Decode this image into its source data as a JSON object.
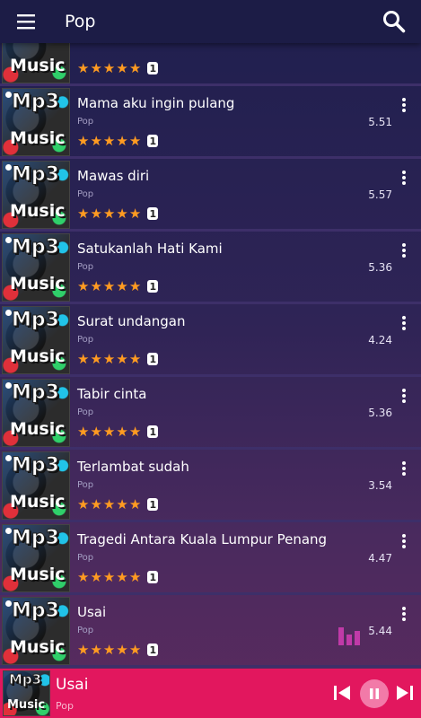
{
  "header": {
    "title": "Pop",
    "menu_icon": "hamburger-menu-icon",
    "search_icon": "search-icon"
  },
  "thumbnail": {
    "top_text": "Mp3",
    "bottom_text": "Music"
  },
  "rating_stars": 5,
  "songs": [
    {
      "title": "",
      "genre": "",
      "duration": "",
      "rating_count": "1"
    },
    {
      "title": "Mama aku ingin pulang",
      "genre": "Pop",
      "duration": "5.51",
      "rating_count": "1"
    },
    {
      "title": "Mawas diri",
      "genre": "Pop",
      "duration": "5.57",
      "rating_count": "1"
    },
    {
      "title": "Satukanlah Hati Kami",
      "genre": "Pop",
      "duration": "5.36",
      "rating_count": "1"
    },
    {
      "title": "Surat undangan",
      "genre": "Pop",
      "duration": "4.24",
      "rating_count": "1"
    },
    {
      "title": "Tabir cinta",
      "genre": "Pop",
      "duration": "5.36",
      "rating_count": "1"
    },
    {
      "title": "Terlambat sudah",
      "genre": "Pop",
      "duration": "3.54",
      "rating_count": "1"
    },
    {
      "title": "Tragedi Antara Kuala Lumpur Penang",
      "genre": "Pop",
      "duration": "4.47",
      "rating_count": "1"
    },
    {
      "title": "Usai",
      "genre": "Pop",
      "duration": "5.44",
      "rating_count": "1",
      "playing": true
    }
  ],
  "player": {
    "title": "Usai",
    "genre": "Pop",
    "accent_color": "#e2175e",
    "state": "playing"
  },
  "colors": {
    "topbar": "#1c1c46",
    "star": "#ff9b21",
    "equalizer": "#c03aa8"
  }
}
